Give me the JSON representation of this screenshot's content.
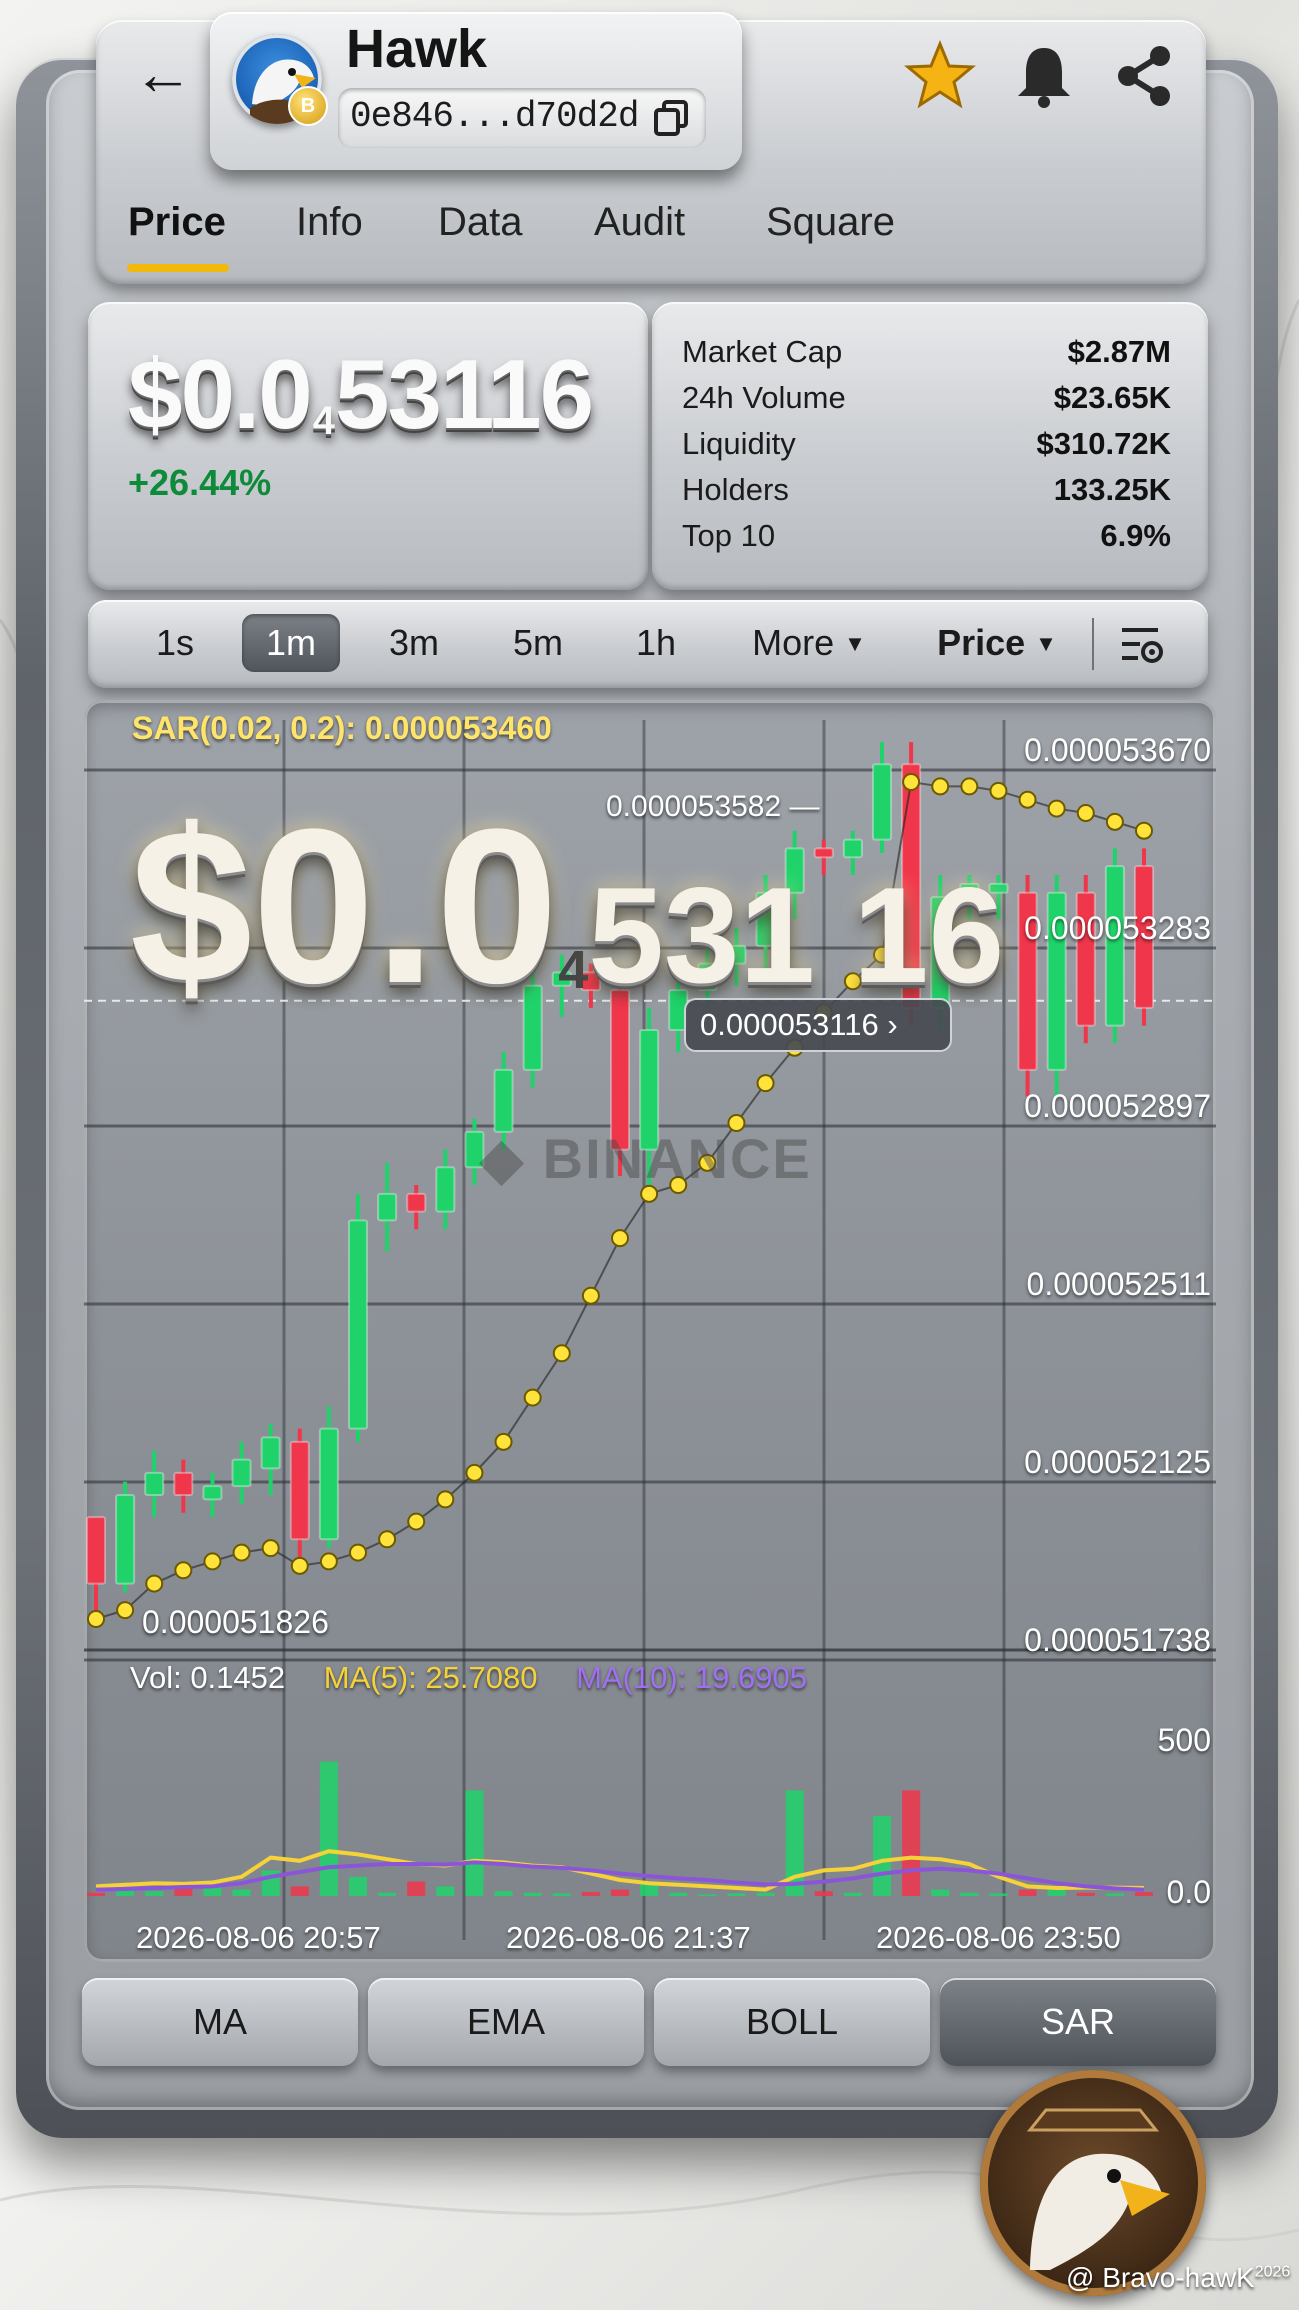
{
  "header": {
    "token_name": "Hawk",
    "address": "0e846...d70d2d",
    "tabs": [
      "Price",
      "Info",
      "Data",
      "Audit",
      "Square"
    ],
    "active_tab": "Price"
  },
  "price": {
    "prefix": "$0.0",
    "zeros": "4",
    "digits": "53116",
    "change": "+26.44%"
  },
  "stats": [
    {
      "label": "Market Cap",
      "value": "$2.87M"
    },
    {
      "label": "24h Volume",
      "value": "$23.65K"
    },
    {
      "label": "Liquidity",
      "value": "$310.72K"
    },
    {
      "label": "Holders",
      "value": "133.25K"
    },
    {
      "label": "Top 10",
      "value": "6.9%"
    }
  ],
  "intervals": [
    "1s",
    "1m",
    "3m",
    "5m",
    "1h"
  ],
  "active_interval": "1m",
  "dropdowns": {
    "more": "More",
    "price": "Price"
  },
  "chart": {
    "sar_label": "SAR(0.02, 0.2): 0.000053460",
    "high_label": "0.000053582",
    "low_label": "0.000051826",
    "current_label": "0.000053116",
    "watermark": "BINANCE",
    "overlay": {
      "big": "$0.0",
      "sub": "4",
      "rest": "531 16"
    },
    "vol_label": "Vol: 0.1452",
    "ma5_label": "MA(5): 25.7080",
    "ma10_label": "MA(10): 19.6905",
    "vol_ticks": [
      "500",
      "0.0"
    ],
    "x_ticks": [
      "2026-08-06 20:57",
      "2026-08-06 21:37",
      "2026-08-06 23:50"
    ]
  },
  "indicators": [
    "MA",
    "EMA",
    "BOLL",
    "SAR"
  ],
  "active_indicator": "SAR",
  "credit": {
    "text": "@ Bravo-hawK",
    "year": "2026"
  },
  "colors": {
    "up": "#1fd36a",
    "down": "#f0364a",
    "sar": "#ffe23a",
    "accent": "#f0b90b",
    "ma5": "#f5d23a",
    "ma10": "#8a55d8"
  },
  "chart_data": {
    "type": "candlestick",
    "title": "",
    "y_ticks": [
      5.367e-05,
      5.3283e-05,
      5.2897e-05,
      5.2511e-05,
      5.2125e-05,
      5.1738e-05
    ],
    "ylim": [
      5.165e-05,
      5.375e-05
    ],
    "grid": true,
    "candles": [
      {
        "o": 5.18e-05,
        "h": 5.188e-05,
        "l": 5.17e-05,
        "c": 5.195e-05,
        "up": false
      },
      {
        "o": 5.18e-05,
        "h": 5.203e-05,
        "l": 5.178e-05,
        "c": 5.2e-05,
        "up": true
      },
      {
        "o": 5.2e-05,
        "h": 5.21e-05,
        "l": 5.195e-05,
        "c": 5.205e-05,
        "up": true
      },
      {
        "o": 5.205e-05,
        "h": 5.208e-05,
        "l": 5.196e-05,
        "c": 5.2e-05,
        "up": false
      },
      {
        "o": 5.199e-05,
        "h": 5.205e-05,
        "l": 5.195e-05,
        "c": 5.202e-05,
        "up": true
      },
      {
        "o": 5.202e-05,
        "h": 5.212e-05,
        "l": 5.198e-05,
        "c": 5.208e-05,
        "up": true
      },
      {
        "o": 5.206e-05,
        "h": 5.216e-05,
        "l": 5.2e-05,
        "c": 5.213e-05,
        "up": true
      },
      {
        "o": 5.212e-05,
        "h": 5.215e-05,
        "l": 5.186e-05,
        "c": 5.19e-05,
        "up": false
      },
      {
        "o": 5.19e-05,
        "h": 5.22e-05,
        "l": 5.188e-05,
        "c": 5.215e-05,
        "up": true
      },
      {
        "o": 5.215e-05,
        "h": 5.268e-05,
        "l": 5.212e-05,
        "c": 5.262e-05,
        "up": true
      },
      {
        "o": 5.262e-05,
        "h": 5.275e-05,
        "l": 5.255e-05,
        "c": 5.268e-05,
        "up": true
      },
      {
        "o": 5.268e-05,
        "h": 5.27e-05,
        "l": 5.26e-05,
        "c": 5.264e-05,
        "up": false
      },
      {
        "o": 5.264e-05,
        "h": 5.278e-05,
        "l": 5.26e-05,
        "c": 5.274e-05,
        "up": true
      },
      {
        "o": 5.274e-05,
        "h": 5.285e-05,
        "l": 5.27e-05,
        "c": 5.282e-05,
        "up": true
      },
      {
        "o": 5.282e-05,
        "h": 5.3e-05,
        "l": 5.278e-05,
        "c": 5.296e-05,
        "up": true
      },
      {
        "o": 5.296e-05,
        "h": 5.32e-05,
        "l": 5.292e-05,
        "c": 5.315e-05,
        "up": true
      },
      {
        "o": 5.315e-05,
        "h": 5.322e-05,
        "l": 5.308e-05,
        "c": 5.318e-05,
        "up": true
      },
      {
        "o": 5.318e-05,
        "h": 5.32e-05,
        "l": 5.31e-05,
        "c": 5.314e-05,
        "up": false
      },
      {
        "o": 5.314e-05,
        "h": 5.318e-05,
        "l": 5.272e-05,
        "c": 5.278e-05,
        "up": false
      },
      {
        "o": 5.278e-05,
        "h": 5.31e-05,
        "l": 5.27e-05,
        "c": 5.305e-05,
        "up": true
      },
      {
        "o": 5.305e-05,
        "h": 5.318e-05,
        "l": 5.3e-05,
        "c": 5.314e-05,
        "up": true
      },
      {
        "o": 5.314e-05,
        "h": 5.325e-05,
        "l": 5.31e-05,
        "c": 5.32e-05,
        "up": true
      },
      {
        "o": 5.32e-05,
        "h": 5.328e-05,
        "l": 5.315e-05,
        "c": 5.324e-05,
        "up": true
      },
      {
        "o": 5.324e-05,
        "h": 5.34e-05,
        "l": 5.318e-05,
        "c": 5.336e-05,
        "up": true
      },
      {
        "o": 5.336e-05,
        "h": 5.35e-05,
        "l": 5.33e-05,
        "c": 5.346e-05,
        "up": true
      },
      {
        "o": 5.346e-05,
        "h": 5.348e-05,
        "l": 5.34e-05,
        "c": 5.344e-05,
        "up": false
      },
      {
        "o": 5.344e-05,
        "h": 5.35e-05,
        "l": 5.34e-05,
        "c": 5.348e-05,
        "up": true
      },
      {
        "o": 5.348e-05,
        "h": 5.37e-05,
        "l": 5.345e-05,
        "c": 5.365e-05,
        "up": true
      },
      {
        "o": 5.365e-05,
        "h": 5.37e-05,
        "l": 5.306e-05,
        "c": 5.31e-05,
        "up": false
      },
      {
        "o": 5.31e-05,
        "h": 5.34e-05,
        "l": 5.305e-05,
        "c": 5.335e-05,
        "up": true
      },
      {
        "o": 5.335e-05,
        "h": 5.34e-05,
        "l": 5.33e-05,
        "c": 5.338e-05,
        "up": true
      },
      {
        "o": 5.338e-05,
        "h": 5.34e-05,
        "l": 5.33e-05,
        "c": 5.336e-05,
        "up": true
      },
      {
        "o": 5.336e-05,
        "h": 5.34e-05,
        "l": 5.29e-05,
        "c": 5.296e-05,
        "up": false
      },
      {
        "o": 5.296e-05,
        "h": 5.34e-05,
        "l": 5.29e-05,
        "c": 5.336e-05,
        "up": true
      },
      {
        "o": 5.336e-05,
        "h": 5.34e-05,
        "l": 5.302e-05,
        "c": 5.306e-05,
        "up": false
      },
      {
        "o": 5.306e-05,
        "h": 5.346e-05,
        "l": 5.302e-05,
        "c": 5.342e-05,
        "up": true
      },
      {
        "o": 5.342e-05,
        "h": 5.346e-05,
        "l": 5.306e-05,
        "c": 5.31e-05,
        "up": false
      }
    ],
    "sar": [
      5.172e-05,
      5.174e-05,
      5.18e-05,
      5.183e-05,
      5.185e-05,
      5.187e-05,
      5.188e-05,
      5.184e-05,
      5.185e-05,
      5.187e-05,
      5.19e-05,
      5.194e-05,
      5.199e-05,
      5.205e-05,
      5.212e-05,
      5.222e-05,
      5.232e-05,
      5.245e-05,
      5.258e-05,
      5.268e-05,
      5.27e-05,
      5.275e-05,
      5.284e-05,
      5.293e-05,
      5.301e-05,
      5.309e-05,
      5.316e-05,
      5.322e-05,
      5.361e-05,
      5.36e-05,
      5.36e-05,
      5.359e-05,
      5.357e-05,
      5.355e-05,
      5.354e-05,
      5.352e-05,
      5.35e-05
    ],
    "volume": [
      10,
      20,
      15,
      25,
      40,
      20,
      80,
      30,
      420,
      60,
      10,
      45,
      30,
      330,
      15,
      10,
      8,
      12,
      20,
      40,
      10,
      5,
      8,
      10,
      330,
      15,
      10,
      250,
      330,
      20,
      10,
      8,
      20,
      30,
      10,
      8,
      12
    ],
    "ma5": [
      30,
      35,
      40,
      38,
      42,
      60,
      120,
      110,
      140,
      130,
      115,
      100,
      95,
      110,
      105,
      95,
      90,
      70,
      50,
      40,
      35,
      30,
      25,
      20,
      60,
      80,
      85,
      110,
      120,
      115,
      100,
      60,
      30,
      25,
      26,
      26,
      25
    ],
    "ma10": [
      20,
      22,
      25,
      28,
      30,
      40,
      60,
      75,
      90,
      95,
      100,
      100,
      98,
      105,
      100,
      92,
      88,
      80,
      70,
      62,
      55,
      50,
      42,
      36,
      38,
      45,
      55,
      70,
      80,
      85,
      80,
      70,
      55,
      40,
      30,
      24,
      20
    ],
    "vol_ylim": [
      0,
      500
    ]
  }
}
